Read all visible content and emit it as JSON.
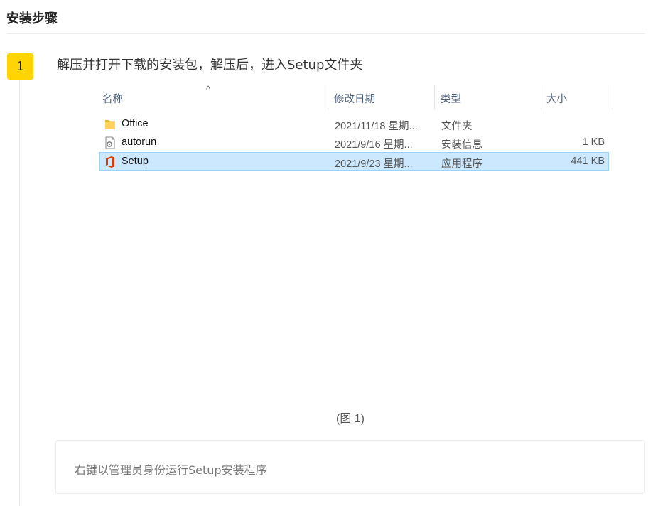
{
  "section": {
    "title": "安装步骤"
  },
  "step": {
    "number": "1",
    "instruction": "解压并打开下载的安装包，解压后，进入Setup文件夹"
  },
  "explorer": {
    "sort_indicator": "^",
    "columns": {
      "name": "名称",
      "date": "修改日期",
      "type": "类型",
      "size": "大小"
    },
    "files": [
      {
        "name": "Office",
        "date": "2021/11/18 星期...",
        "type": "文件夹",
        "size": "",
        "icon": "folder-icon",
        "selected": false
      },
      {
        "name": "autorun",
        "date": "2021/9/16 星期...",
        "type": "安装信息",
        "size": "1 KB",
        "icon": "setup-info-file-icon",
        "selected": false
      },
      {
        "name": "Setup",
        "date": "2021/9/23 星期...",
        "type": "应用程序",
        "size": "441 KB",
        "icon": "office-app-icon",
        "selected": true
      }
    ],
    "colors": {
      "selection_bg": "#cce8ff",
      "selection_border": "#99d1ff",
      "office_red": "#d83b01",
      "folder_yellow": "#ffd35c"
    }
  },
  "figure": {
    "caption": "(图 1)"
  },
  "note": {
    "text": "右键以管理员身份运行Setup安装程序"
  },
  "colors": {
    "badge": "#ffd400"
  }
}
